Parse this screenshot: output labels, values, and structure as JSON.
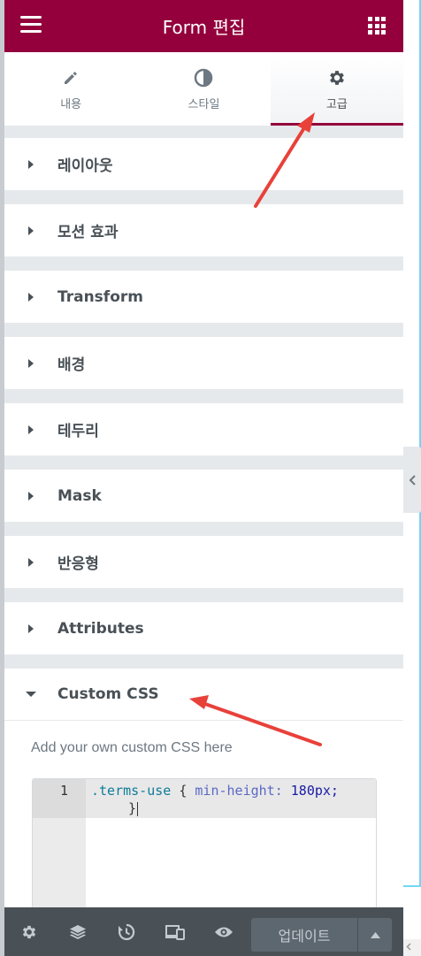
{
  "header": {
    "title": "Form 편집"
  },
  "tabs": [
    {
      "label": "내용",
      "icon": "pencil-icon"
    },
    {
      "label": "스타일",
      "icon": "contrast-icon"
    },
    {
      "label": "고급",
      "icon": "gear-icon",
      "active": true
    }
  ],
  "sections": [
    {
      "label": "레이아웃"
    },
    {
      "label": "모션 효과"
    },
    {
      "label": "Transform"
    },
    {
      "label": "배경"
    },
    {
      "label": "테두리"
    },
    {
      "label": "Mask"
    },
    {
      "label": "반응형"
    },
    {
      "label": "Attributes"
    }
  ],
  "custom_css": {
    "title": "Custom CSS",
    "description": "Add your own custom CSS here",
    "line_number": "1",
    "code": {
      "selector": ".terms-use",
      "open_brace": "{",
      "property": "min-height:",
      "value": "180px;",
      "close_brace": "}"
    }
  },
  "footer": {
    "update_label": "업데이트"
  },
  "colors": {
    "brand": "#93003c",
    "footer": "#495157",
    "annotation_arrow": "#e8413a"
  }
}
